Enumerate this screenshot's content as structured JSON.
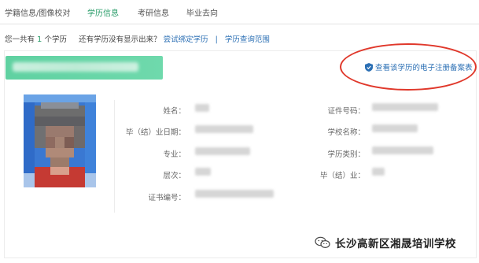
{
  "tabs": [
    {
      "label": "学籍信息/图像校对",
      "active": false
    },
    {
      "label": "学历信息",
      "active": true
    },
    {
      "label": "考研信息",
      "active": false
    },
    {
      "label": "毕业去向",
      "active": false
    }
  ],
  "summary": {
    "prefix": "您一共有",
    "count": "1",
    "suffix": "个学历",
    "question": "还有学历没有显示出来？",
    "bind_link": "尝试绑定学历",
    "separator": "|",
    "scope_link": "学历查询范围"
  },
  "record": {
    "register_link": "查看该学历的电子注册备案表",
    "fields_left": [
      {
        "label": "姓名："
      },
      {
        "label": "毕（结）业日期："
      },
      {
        "label": "专业："
      },
      {
        "label": "层次："
      },
      {
        "label": "证书编号："
      }
    ],
    "fields_right": [
      {
        "label": "证件号码："
      },
      {
        "label": "学校名称："
      },
      {
        "label": "学历类别："
      },
      {
        "label": "毕（结）业："
      }
    ]
  },
  "watermark": {
    "text": "长沙高新区湘晟培训学校",
    "icon": "wechat-icon"
  },
  "colors": {
    "accent_green": "#2a9d6a",
    "banner_green": "#62d4a5",
    "link_blue": "#2b6fb4",
    "annotation_red": "#e0382b"
  }
}
